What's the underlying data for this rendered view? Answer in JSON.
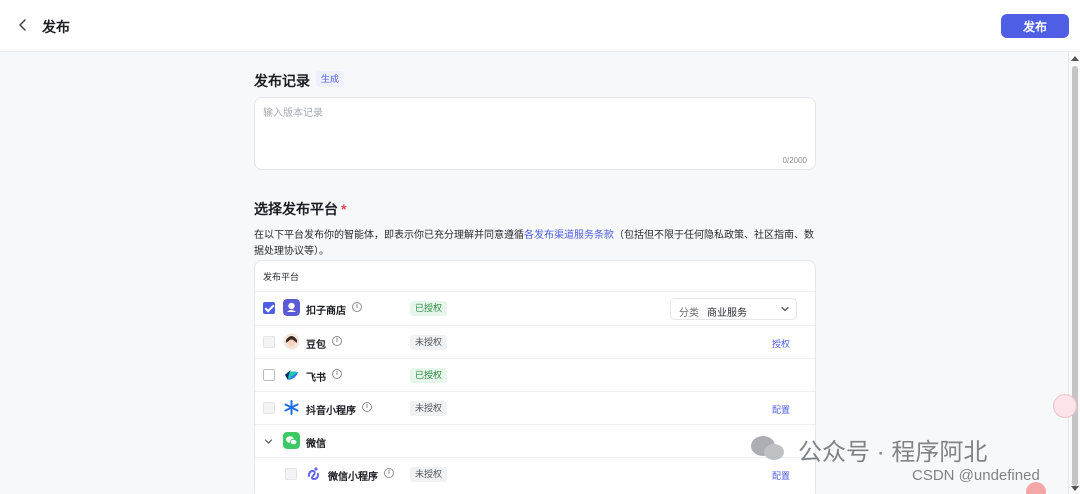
{
  "header": {
    "title": "发布",
    "publish_label": "发布"
  },
  "release_notes": {
    "title": "发布记录",
    "generate_label": "生成",
    "placeholder": "输入版本记录",
    "char_count": "0/2000"
  },
  "platform_section": {
    "title": "选择发布平台",
    "required_mark": "*",
    "desc_prefix": "在以下平台发布你的智能体，即表示你已充分理解并同意遵循",
    "desc_link": "各发布渠道服务条款",
    "desc_suffix": "（包括但不限于任何隐私政策、社区指南、数据处理协议等）。",
    "table_header": "发布平台",
    "category_label": "分类",
    "category_value": "商业服务",
    "platforms": [
      {
        "name": "扣子商店",
        "status": "已授权",
        "action": ""
      },
      {
        "name": "豆包",
        "status": "未授权",
        "action": "授权"
      },
      {
        "name": "飞书",
        "status": "已授权",
        "action": ""
      },
      {
        "name": "抖音小程序",
        "status": "未授权",
        "action": "配置"
      },
      {
        "name": "微信",
        "status": "",
        "action": ""
      },
      {
        "name": "微信小程序",
        "status": "未授权",
        "action": "配置"
      }
    ]
  },
  "watermark": {
    "text": "公众号 · 程序阿北",
    "csdn": "CSDN @undefined"
  },
  "colors": {
    "accent": "#4e5fe6",
    "authorized_bg": "#e6f6ea",
    "authorized_text": "#2f8a44"
  }
}
